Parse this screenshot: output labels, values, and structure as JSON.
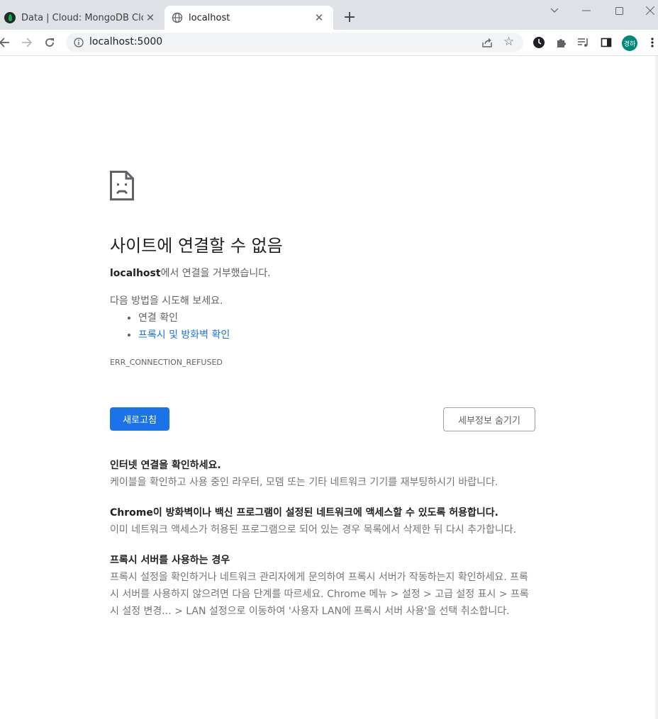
{
  "browser": {
    "tabs": [
      {
        "title": "Data | Cloud: MongoDB Cloud",
        "active": false,
        "favicon": "mongodb-leaf-icon"
      },
      {
        "title": "localhost",
        "active": true,
        "favicon": "globe-icon"
      }
    ],
    "address": "localhost:5000",
    "profile_initials": "경하",
    "accent_color": "#1a73e8"
  },
  "error_page": {
    "heading": "사이트에 연결할 수 없음",
    "host": "localhost",
    "message_suffix": "에서 연결을 거부했습니다.",
    "try_label": "다음 방법을 시도해 보세요.",
    "suggestions": [
      {
        "text": "연결 확인",
        "link": false
      },
      {
        "text": "프록시 및 방화벽 확인",
        "link": true
      }
    ],
    "error_code": "ERR_CONNECTION_REFUSED",
    "reload_label": "새로고침",
    "details_label": "세부정보 숨기기",
    "details": [
      {
        "title": "인터넷 연결을 확인하세요.",
        "body": "케이블을 확인하고 사용 중인 라우터, 모뎀 또는 기타 네트워크 기기를 재부팅하시기 바랍니다."
      },
      {
        "title": "Chrome이 방화벽이나 백신 프로그램이 설정된 네트워크에 액세스할 수 있도록 허용합니다.",
        "body": "이미 네트워크 액세스가 허용된 프로그램으로 되어 있는 경우 목록에서 삭제한 뒤 다시 추가합니다."
      },
      {
        "title": "프록시 서버를 사용하는 경우",
        "body": "프록시 설정을 확인하거나 네트워크 관리자에게 문의하여 프록시 서버가 작동하는지 확인하세요. 프록시 서버를 사용하지 않으려면 다음 단계를 따르세요. Chrome 메뉴 > 설정 > 고급 설정 표시 > 프록시 설정 변경... > LAN 설정으로 이동하여 '사용자 LAN에 프록시 서버 사용'을 선택 취소합니다."
      }
    ]
  }
}
